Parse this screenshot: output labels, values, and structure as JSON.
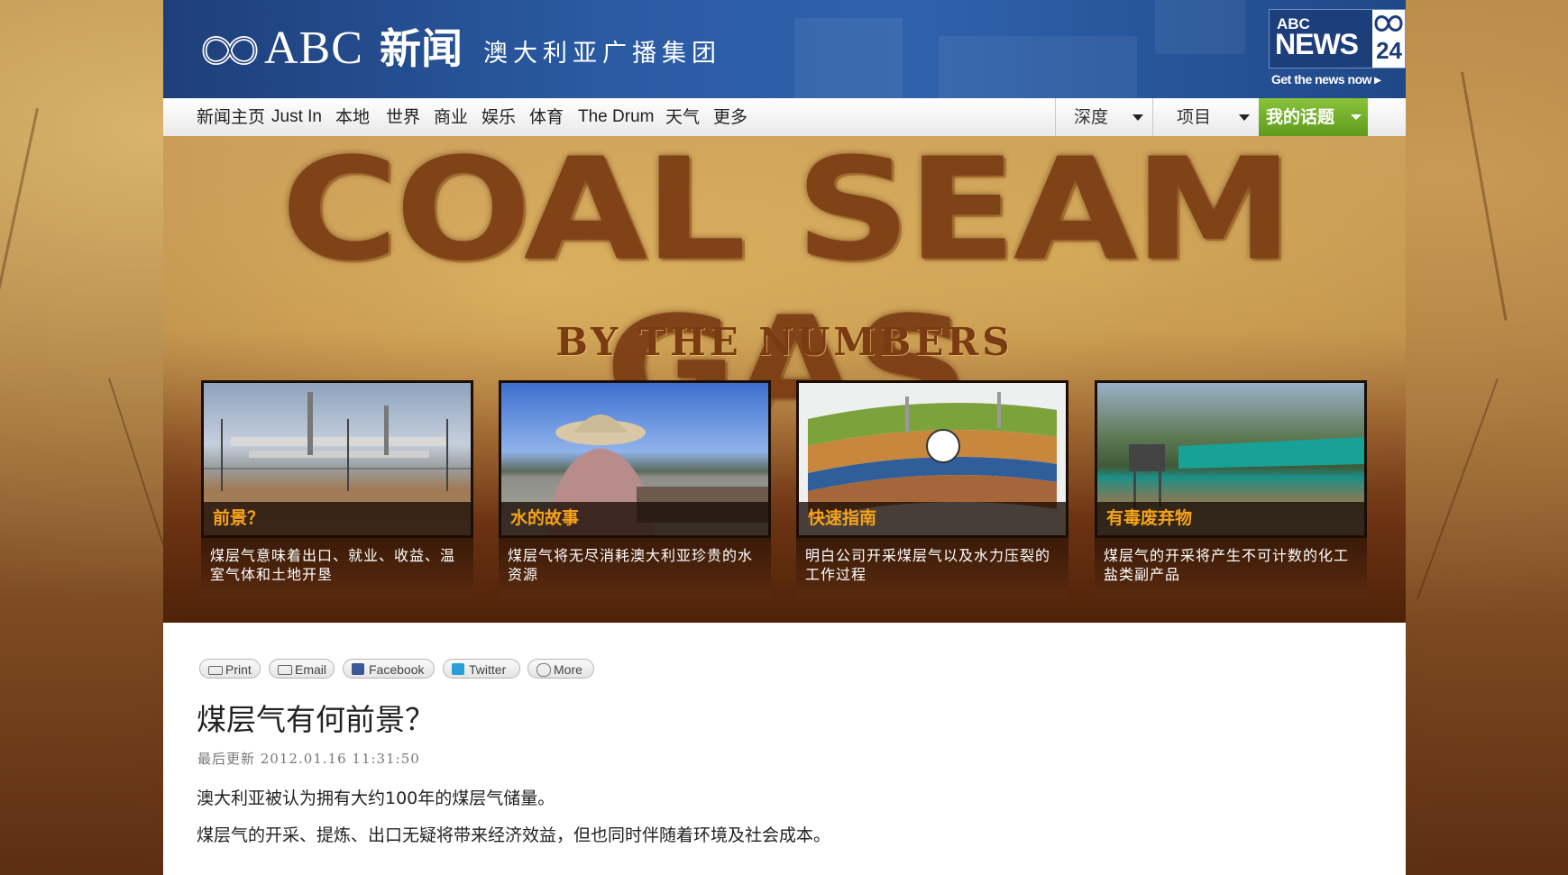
{
  "header": {
    "brand": "ABC",
    "brand_cn": "新闻",
    "subtitle": "澳大利亚广播集团",
    "news24": {
      "abc": "ABC",
      "news": "NEWS",
      "number": "24",
      "tagline": "Get the news now ▸"
    }
  },
  "nav": {
    "items": [
      "新闻主页",
      "Just In",
      "本地",
      "世界",
      "商业",
      "娱乐",
      "体育",
      "The Drum",
      "天气",
      "更多"
    ],
    "dropdowns": [
      "深度",
      "项目"
    ],
    "my_topics": "我的话题"
  },
  "banner": {
    "title": "COAL SEAM GAS",
    "subtitle": "BY THE NUMBERS",
    "cards": [
      {
        "label": "前景？",
        "desc": "煤层气意味着出口、就业、收益、温室气体和土地开垦"
      },
      {
        "label": "水的故事",
        "desc": "煤层气将无尽消耗澳大利亚珍贵的水资源"
      },
      {
        "label": "快速指南",
        "desc": "明白公司开采煤层气以及水力压裂的工作过程"
      },
      {
        "label": "有毒废弃物",
        "desc": "煤层气的开采将产生不可计数的化工盐类副产品"
      }
    ]
  },
  "share": {
    "print": "Print",
    "email": "Email",
    "facebook": "Facebook",
    "twitter": "Twitter",
    "more": "More"
  },
  "article": {
    "title": "煤层气有何前景？",
    "updated": "最后更新 2012.01.16 11:31:50",
    "paragraphs": [
      "澳大利亚被认为拥有大约100年的煤层气储量。",
      "煤层气的开采、提炼、出口无疑将带来经济效益，但也同时伴随着环境及社会成本。"
    ]
  },
  "colors": {
    "header_blue": "#2a5aa2",
    "accent_orange": "#f7a21b",
    "topics_green": "#6aa823"
  }
}
